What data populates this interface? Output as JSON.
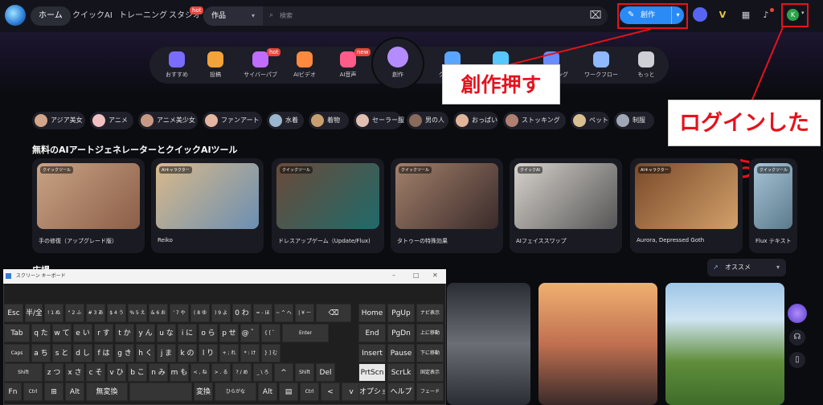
{
  "nav": {
    "home": "ホーム",
    "quick_ai": "クイックAI",
    "training": "トレーニング",
    "studio": "スタジオ",
    "studio_badge": "hot"
  },
  "search": {
    "category": "作品",
    "placeholder": "検索"
  },
  "create_button": "創作",
  "user_initial": "K",
  "categories": [
    {
      "label": "おすすめ",
      "icon": "star-icon",
      "color": "#7a6cff"
    },
    {
      "label": "投稿",
      "icon": "post-icon",
      "color": "#f2a33a"
    },
    {
      "label": "サイバーパブ",
      "icon": "cyber-pub-icon",
      "color": "#c06cff",
      "badge": "hot"
    },
    {
      "label": "AIビデオ",
      "icon": "video-icon",
      "color": "#ff8a3d"
    },
    {
      "label": "AI音声",
      "icon": "voice-icon",
      "color": "#ff5c8a",
      "badge": "new"
    },
    {
      "label": "創作",
      "icon": "create-icon",
      "color": "#b58cff"
    },
    {
      "label": "クイックAI",
      "icon": "quick-ai-icon",
      "color": "#5aa6ff"
    },
    {
      "label": "トレーニング",
      "icon": "training-icon",
      "color": "#56c8ff"
    },
    {
      "label": "トレーニング",
      "icon": "training-icon",
      "color": "#6a8cff"
    },
    {
      "label": "ワークフロー",
      "icon": "workflow-icon",
      "color": "#8fb8ff"
    },
    {
      "label": "もっと",
      "icon": "more-icon",
      "color": "#cfd0d6"
    }
  ],
  "callouts": {
    "create": "創作押す",
    "login": "ログインしたら"
  },
  "tags": [
    "アジア美女",
    "アニメ",
    "アニメ美少女",
    "ファンアート",
    "水着",
    "着物",
    "セーラー服",
    "男の人",
    "おっぱい",
    "ストッキング",
    "ペット",
    "制服"
  ],
  "tools_section_title": "無料のAIアートジェネレーターとクイックAIツール",
  "tools": [
    {
      "tag": "クイックツール",
      "caption": "手の修復（アップグレード版）",
      "colors": [
        "#c9a384",
        "#8b5e48"
      ]
    },
    {
      "tag": "AIキャラクター",
      "caption": "Reiko",
      "colors": [
        "#d9b98a",
        "#6b8fb3"
      ]
    },
    {
      "tag": "クイックツール",
      "caption": "ドレスアップゲーム（Update/Flux)",
      "colors": [
        "#6b4a3a",
        "#1f6a6a"
      ]
    },
    {
      "tag": "クイックツール",
      "caption": "タトゥーの特殊効果",
      "colors": [
        "#a2806a",
        "#3a2a2a"
      ]
    },
    {
      "tag": "クイックAI",
      "caption": "AIフェイススワップ",
      "colors": [
        "#d7d2cc",
        "#555555"
      ]
    },
    {
      "tag": "AIキャラクター",
      "caption": "Aurora, Depressed Goth",
      "colors": [
        "#7a4a2a",
        "#d2a06a"
      ]
    },
    {
      "tag": "クイックツール",
      "caption": "Flux テキスト",
      "colors": [
        "#a8c4d8",
        "#5a7a8a"
      ]
    }
  ],
  "square_title": "広場",
  "sort_label": "オススメ",
  "keyboard": {
    "title": "スクリーン キーボード",
    "rows": [
      [
        "Esc",
        "半/全",
        "!\n1 ぬ",
        "\"\n2 ふ",
        "#\n3 あ",
        "$\n4 う",
        "%\n5 え",
        "&\n6 お",
        "'\n7 や",
        "(\n8 ゆ",
        ")\n9 よ",
        "0 わ",
        "=\n- ほ",
        "~\n^ へ",
        "|\n¥ ー",
        "⌫"
      ],
      [
        "Tab",
        "q た",
        "w て",
        "e い",
        "r す",
        "t か",
        "y ん",
        "u な",
        "i に",
        "o ら",
        "p せ",
        "@ ゛",
        "{\n[ ゜",
        "Enter"
      ],
      [
        "Caps",
        "a ち",
        "s と",
        "d し",
        "f は",
        "g き",
        "h く",
        "j ま",
        "k の",
        "l り",
        "+\n; れ",
        "*\n: け",
        "}\n] む"
      ],
      [
        "Shift",
        "z つ",
        "x さ",
        "c そ",
        "v ひ",
        "b こ",
        "n み",
        "m も",
        "<\n, ね",
        ">\n. る",
        "?\n/ め",
        "_\n\\ ろ",
        "^",
        "Shift",
        "Del"
      ],
      [
        "Fn",
        "Ctrl",
        "⊞",
        "Alt",
        "無変換",
        "",
        "変換",
        "ひらがな",
        "Alt",
        "▤",
        "Ctrl",
        "<",
        "v",
        ">"
      ]
    ],
    "side_keys": [
      "Home",
      "PgUp",
      "ナビ表示",
      "End",
      "PgDn",
      "上に移動",
      "Insert",
      "Pause",
      "下に移動",
      "PrtScn",
      "ScrLk",
      "固定表示",
      "オプション",
      "ヘルプ",
      "フェード"
    ]
  }
}
